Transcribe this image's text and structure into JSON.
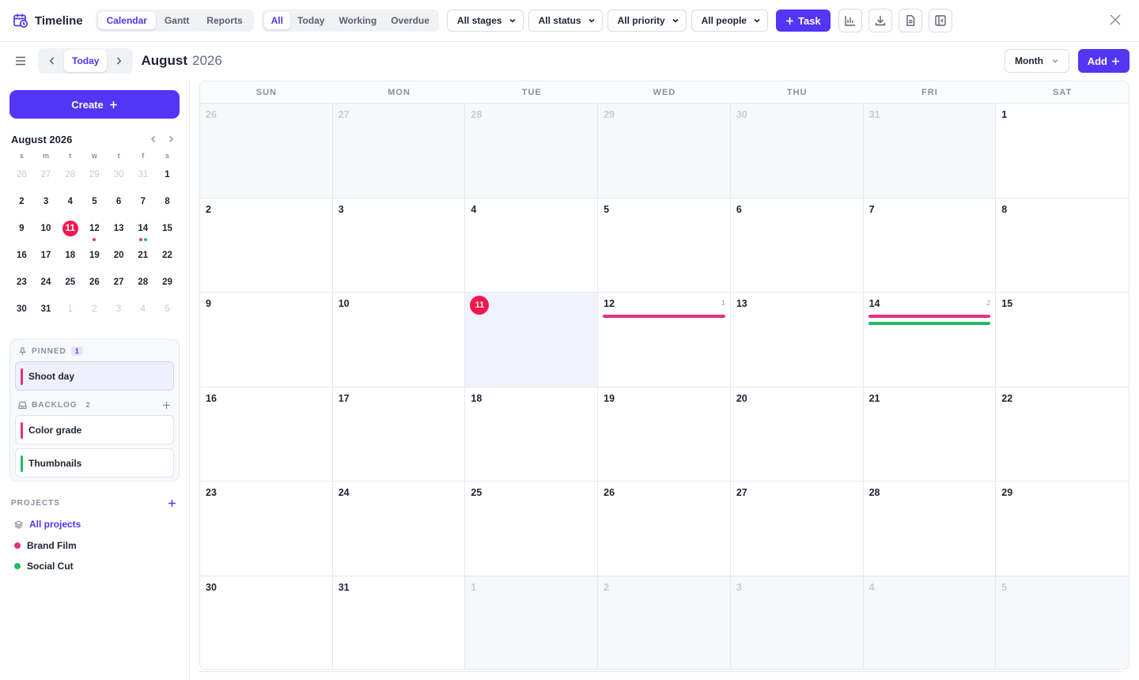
{
  "app": {
    "title": "Timeline"
  },
  "views": [
    "Calendar",
    "Gantt",
    "Reports"
  ],
  "active_view": "Calendar",
  "quick_filters": [
    "All",
    "Today",
    "Working",
    "Overdue"
  ],
  "active_filter": "All",
  "dropdowns": {
    "stages": "All stages",
    "status": "All status",
    "priority": "All priority",
    "people": "All people"
  },
  "toolbar": {
    "task_label": "Task",
    "icons": [
      "chart-icon",
      "download-icon",
      "document-icon",
      "sidebar-collapse-icon"
    ]
  },
  "subbar": {
    "today_label": "Today",
    "month": "August",
    "year": "2026",
    "view_select": "Month",
    "add_label": "Add"
  },
  "sidebar": {
    "create_label": "Create",
    "mini_title": "August 2026",
    "dow": [
      "s",
      "m",
      "t",
      "w",
      "t",
      "f",
      "s"
    ],
    "weeks": [
      [
        "26",
        "27",
        "28",
        "29",
        "30",
        "31",
        "1"
      ],
      [
        "2",
        "3",
        "4",
        "5",
        "6",
        "7",
        "8"
      ],
      [
        "9",
        "10",
        "11",
        "12",
        "13",
        "14",
        "15"
      ],
      [
        "16",
        "17",
        "18",
        "19",
        "20",
        "21",
        "22"
      ],
      [
        "23",
        "24",
        "25",
        "26",
        "27",
        "28",
        "29"
      ],
      [
        "30",
        "31",
        "1",
        "2",
        "3",
        "4",
        "5"
      ]
    ],
    "pinned": {
      "label": "PINNED",
      "count": "1",
      "items": [
        {
          "title": "Shoot day",
          "color": "#e5307f"
        }
      ]
    },
    "backlog": {
      "label": "BACKLOG",
      "count": "2",
      "items": [
        {
          "title": "Color grade",
          "color": "#e5307f"
        },
        {
          "title": "Thumbnails",
          "color": "#1ebe64"
        }
      ]
    },
    "projects": {
      "label": "PROJECTS",
      "items": [
        {
          "name": "All projects",
          "active": true
        },
        {
          "name": "Brand Film",
          "color": "#e5307f"
        },
        {
          "name": "Social Cut",
          "color": "#1ebe64"
        }
      ]
    }
  },
  "calendar": {
    "dow": [
      "SUN",
      "MON",
      "TUE",
      "WED",
      "THU",
      "FRI",
      "SAT"
    ],
    "weeks": [
      [
        "26",
        "27",
        "28",
        "29",
        "30",
        "31",
        "1"
      ],
      [
        "2",
        "3",
        "4",
        "5",
        "6",
        "7",
        "8"
      ],
      [
        "9",
        "10",
        "11",
        "12",
        "13",
        "14",
        "15"
      ],
      [
        "16",
        "17",
        "18",
        "19",
        "20",
        "21",
        "22"
      ],
      [
        "23",
        "24",
        "25",
        "26",
        "27",
        "28",
        "29"
      ],
      [
        "30",
        "31",
        "1",
        "2",
        "3",
        "4",
        "5"
      ]
    ],
    "today": "11",
    "events": {
      "12": {
        "count": "1",
        "colors": [
          "#e5307f"
        ]
      },
      "14": {
        "count": "2",
        "colors": [
          "#e5307f",
          "#1ebe64"
        ]
      }
    }
  },
  "colors": {
    "accent": "#5235f5",
    "today": "#f2174f",
    "pink": "#e5307f",
    "green": "#1ebe64"
  }
}
